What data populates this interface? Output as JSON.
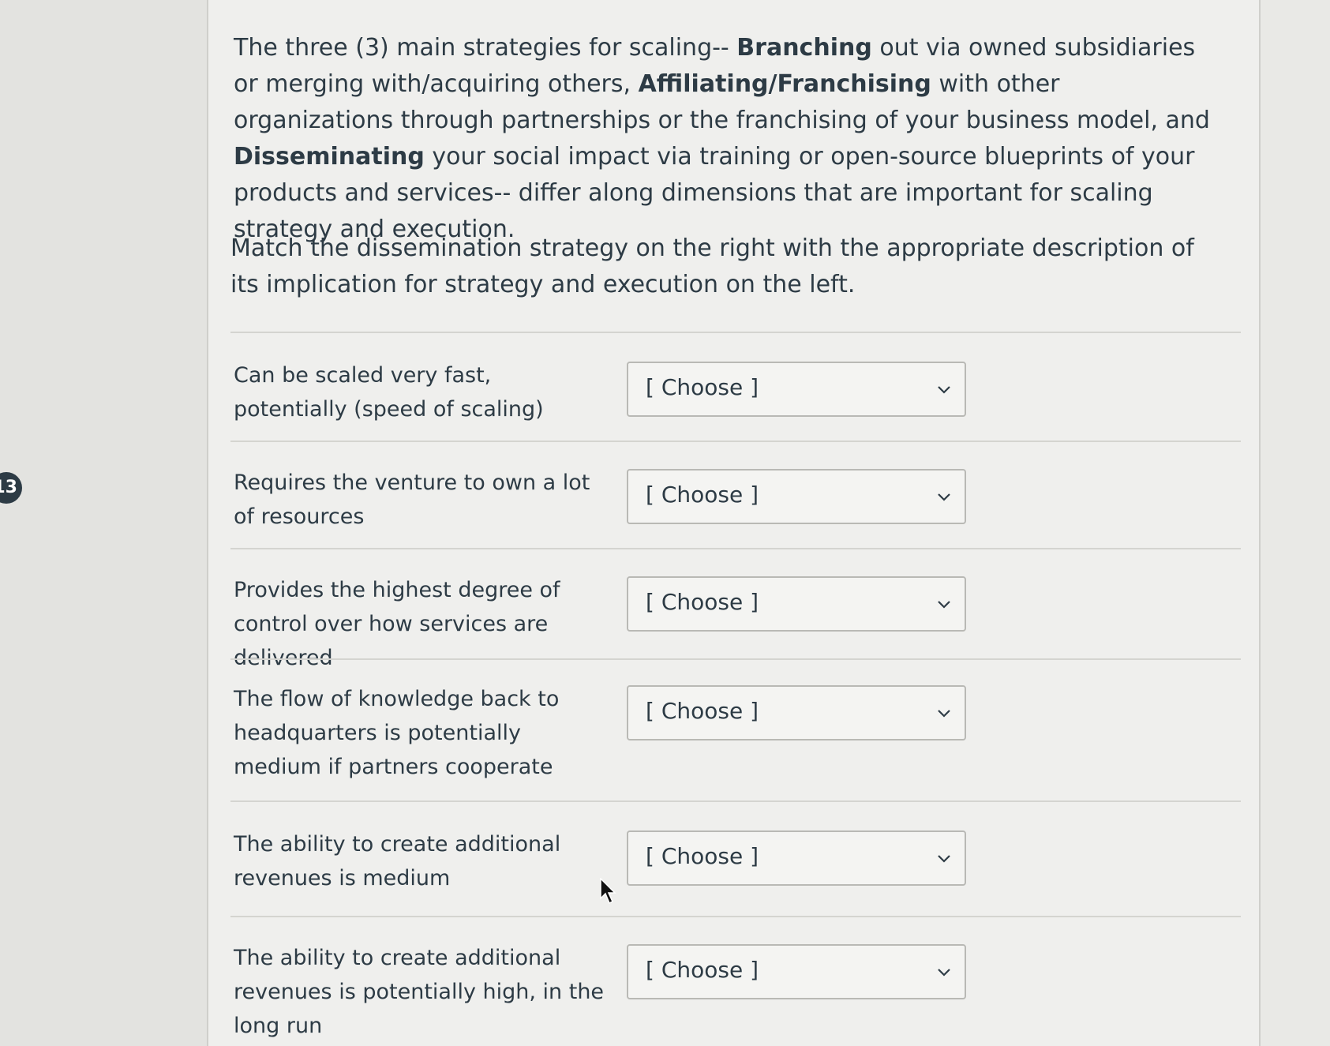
{
  "badge": {
    "number": "13"
  },
  "prompt": {
    "p1_a": "The three (3) main strategies for scaling-- ",
    "p1_b_bold": "Branching",
    "p1_c": " out via owned subsidiaries or merging with/acquiring others, ",
    "p1_d_bold": "Affiliating/Franchising",
    "p1_e": " with other organizations through partnerships or the franchising of your business model, and ",
    "p1_f_bold": "Disseminating",
    "p1_g": " your social impact via training or open-source blueprints of your products and services-- differ along dimensions that are important for scaling strategy and execution.",
    "instruction": "Match the dissemination strategy on the right with the appropriate description of its implication for strategy and execution on the left."
  },
  "matches": [
    {
      "label": "Can be scaled very fast, potentially (speed of scaling)",
      "selected": "[ Choose ]"
    },
    {
      "label": "Requires the venture to own a lot of resources",
      "selected": "[ Choose ]"
    },
    {
      "label": "Provides the highest degree of control over how services are delivered",
      "selected": "[ Choose ]"
    },
    {
      "label": "The flow of knowledge back to headquarters is potentially medium if partners cooperate",
      "selected": "[ Choose ]"
    },
    {
      "label": "The ability to create additional revenues is medium",
      "selected": "[ Choose ]"
    },
    {
      "label": "The ability to create additional revenues is potentially high, in the long run",
      "selected": "[ Choose ]"
    }
  ],
  "icons": {
    "dropdown": "chevron-down-icon",
    "cursor": "mouse-pointer-icon"
  }
}
